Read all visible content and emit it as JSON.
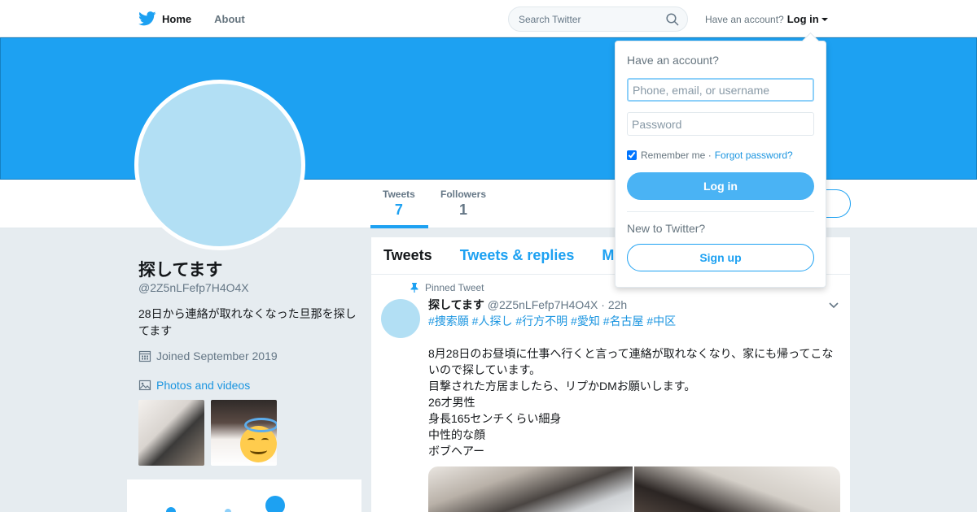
{
  "colors": {
    "accent": "#1da1f2",
    "banner": "#1da1f2",
    "link": "#1b95e0",
    "avatar_placeholder": "#b2dff4",
    "background": "#e6ecf0"
  },
  "nav": {
    "logo_icon": "twitter-bird-icon",
    "home_label": "Home",
    "about_label": "About",
    "search_placeholder": "Search Twitter",
    "login_prompt": "Have an account?",
    "login_label": "Log in"
  },
  "profile": {
    "name": "探してます",
    "handle": "@2Z5nLFefp7H4O4X",
    "bio": "28日から連絡が取れなくなった旦那を探してます",
    "joined": "Joined September 2019",
    "photos_label": "Photos and videos",
    "stats": [
      {
        "label": "Tweets",
        "value": "7"
      },
      {
        "label": "Followers",
        "value": "1"
      }
    ]
  },
  "timeline": {
    "tabs": [
      "Tweets",
      "Tweets & replies",
      "M"
    ],
    "pinned_label": "Pinned Tweet",
    "tweet": {
      "author": "探してます",
      "handle": "@2Z5nLFefp7H4O4X",
      "time": "· 22h",
      "hashtags": "#捜索願 #人探し #行方不明 #愛知 #名古屋 #中区",
      "lines": [
        "8月28日のお昼頃に仕事へ行くと言って連絡が取れなくなり、家にも帰ってこないので探しています。",
        "目撃された方居ましたら、リプかDMお願いします。",
        "26才男性",
        "身長165センチくらい細身",
        "中性的な顔",
        "ボブヘアー"
      ]
    }
  },
  "login_dropdown": {
    "title": "Have an account?",
    "username_placeholder": "Phone, email, or username",
    "password_placeholder": "Password",
    "remember_label": "Remember me ·",
    "forgot_label": "Forgot password?",
    "login_button": "Log in",
    "new_prompt": "New to Twitter?",
    "signup_button": "Sign up"
  }
}
